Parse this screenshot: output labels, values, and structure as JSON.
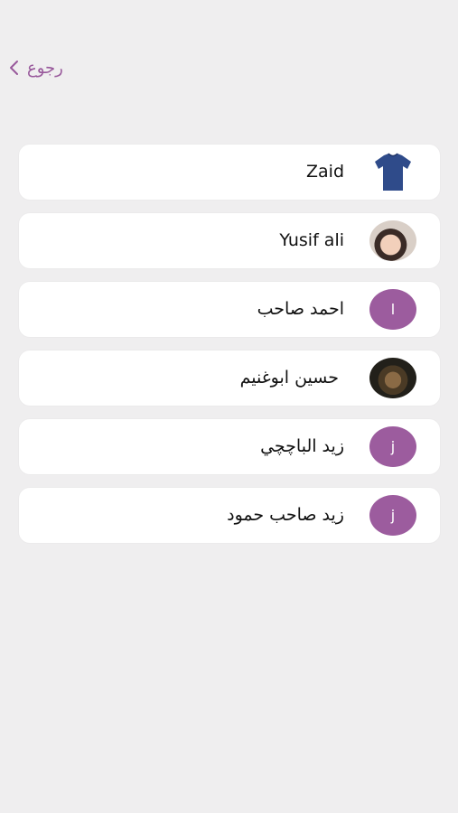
{
  "header": {
    "back_label": "رجوع"
  },
  "contacts": [
    {
      "name": "Zaid",
      "avatar": "tshirt-icon",
      "avatar_letter": ""
    },
    {
      "name": "Yusif ali",
      "avatar": "photo",
      "avatar_letter": ""
    },
    {
      "name": "احمد صاحب",
      "avatar": "letter",
      "avatar_letter": "ا"
    },
    {
      "name": "حسين ابوغنيم",
      "avatar": "photo",
      "avatar_letter": ""
    },
    {
      "name": "زيد الباچچي",
      "avatar": "letter",
      "avatar_letter": "j"
    },
    {
      "name": "زيد صاحب حمود",
      "avatar": "letter",
      "avatar_letter": "j"
    }
  ],
  "colors": {
    "accent": "#9c5c9e",
    "background": "#efeeef",
    "card": "#ffffff"
  }
}
